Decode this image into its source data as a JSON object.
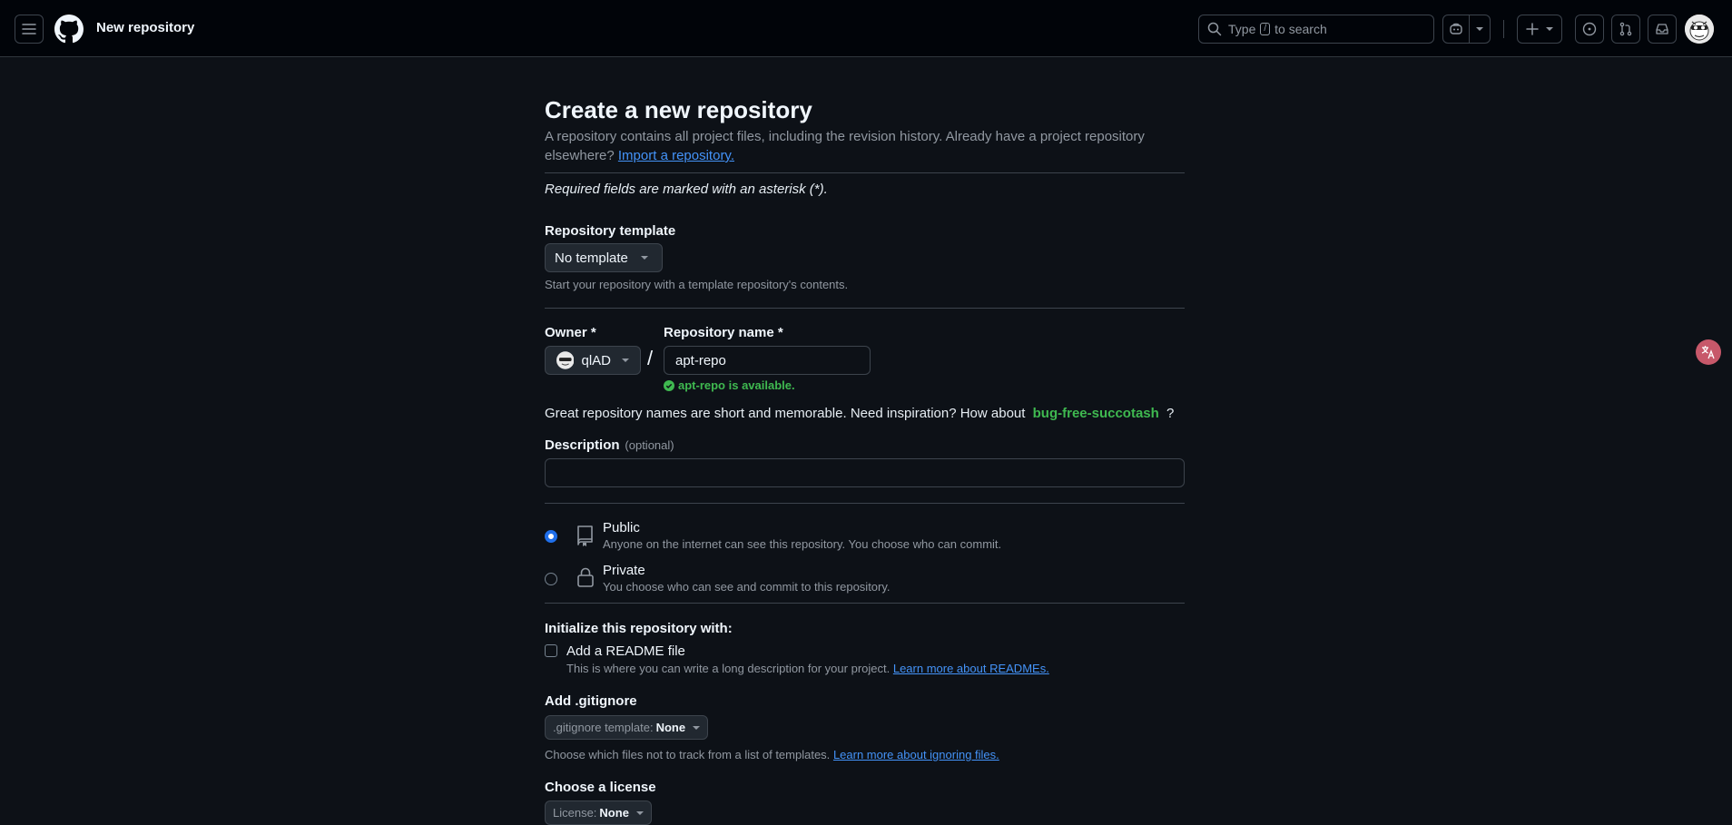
{
  "header": {
    "title": "New repository",
    "search_prefix": "Type",
    "search_key": "/",
    "search_suffix": "to search"
  },
  "page": {
    "title": "Create a new repository",
    "subtitle": "A repository contains all project files, including the revision history. Already have a project repository elsewhere?",
    "import_link": "Import a repository.",
    "required_note": "Required fields are marked with an asterisk (*)."
  },
  "template": {
    "label": "Repository template",
    "value": "No template",
    "hint": "Start your repository with a template repository's contents."
  },
  "owner": {
    "label": "Owner *",
    "value": "qlAD"
  },
  "repo_name": {
    "label": "Repository name *",
    "value": "apt-repo",
    "availability": "apt-repo is available."
  },
  "separator": "/",
  "inspiration": {
    "text": "Great repository names are short and memorable. Need inspiration? How about",
    "suggestion": "bug-free-succotash",
    "suffix": "?"
  },
  "description": {
    "label": "Description",
    "optional": "(optional)",
    "value": ""
  },
  "visibility": {
    "public_title": "Public",
    "public_desc": "Anyone on the internet can see this repository. You choose who can commit.",
    "private_title": "Private",
    "private_desc": "You choose who can see and commit to this repository.",
    "selected": "public"
  },
  "init": {
    "heading": "Initialize this repository with:",
    "readme_label": "Add a README file",
    "readme_desc": "This is where you can write a long description for your project.",
    "readme_link": "Learn more about READMEs.",
    "readme_checked": false
  },
  "gitignore": {
    "label": "Add .gitignore",
    "prefix": ".gitignore template:",
    "value": "None",
    "hint": "Choose which files not to track from a list of templates.",
    "link": "Learn more about ignoring files."
  },
  "license": {
    "label": "Choose a license",
    "prefix": "License:",
    "value": "None"
  },
  "colors": {
    "background": "#0d1117",
    "header": "#010409",
    "accent": "#4493f8",
    "success": "#3fb950",
    "border": "#3d444d"
  }
}
